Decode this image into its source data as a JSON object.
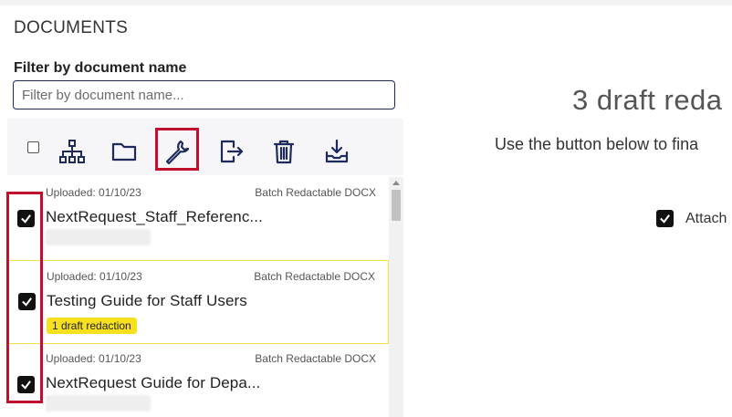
{
  "section_title": "DOCUMENTS",
  "filter": {
    "label": "Filter by document name",
    "placeholder": "Filter by document name..."
  },
  "toolbar": {
    "icons": [
      "select-all-checkbox",
      "hierarchy-icon",
      "folder-icon",
      "wrench-icon",
      "export-icon",
      "trash-icon",
      "download-icon"
    ]
  },
  "documents": [
    {
      "uploaded": "Uploaded: 01/10/23",
      "kind": "Batch Redactable DOCX",
      "name": "NextRequest_Staff_Referenc...",
      "badge": ""
    },
    {
      "uploaded": "Uploaded: 01/10/23",
      "kind": "Batch Redactable DOCX",
      "name": "Testing Guide for Staff Users",
      "badge": "1 draft redaction"
    },
    {
      "uploaded": "Uploaded: 01/10/23",
      "kind": "Batch Redactable DOCX",
      "name": "NextRequest Guide for Depa...",
      "badge": ""
    }
  ],
  "right_panel": {
    "title": "3 draft reda",
    "subtitle": "Use the button below to fina",
    "attach_label": "Attach"
  },
  "colors": {
    "highlight": "#c00f2c",
    "badge": "#f7e11f",
    "icon": "#1f2a5c",
    "selected_border": "#f0e04a"
  }
}
